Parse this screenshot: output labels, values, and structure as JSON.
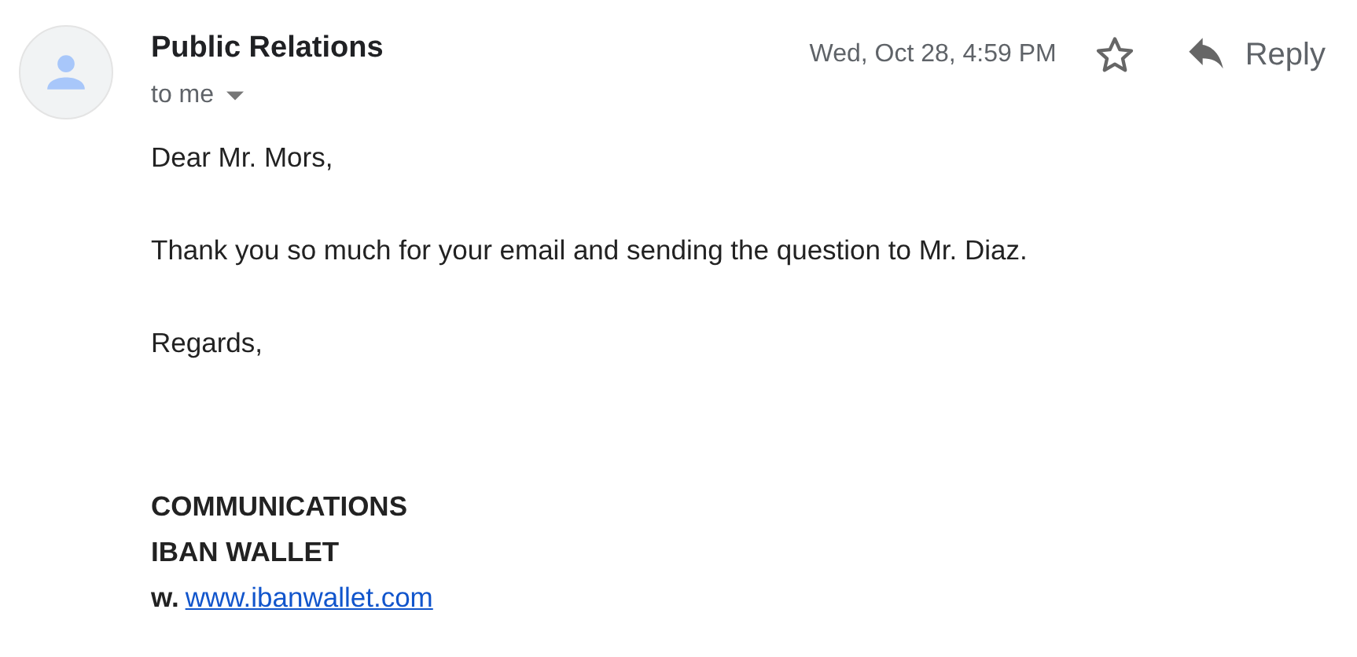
{
  "sender": {
    "name": "Public Relations",
    "recipient": "to me"
  },
  "date": "Wed, Oct 28, 4:59 PM",
  "starred": false,
  "reply_button": {
    "label": "Reply"
  },
  "body": [
    "Dear Mr. Mors,",
    "Thank you so much for your email and sending the question to Mr. Diaz.",
    "Regards,"
  ],
  "signature": {
    "lines": [
      "COMMUNICATIONS",
      "IBAN WALLET"
    ],
    "website_label": "w.",
    "website": "www.ibanwallet.com"
  }
}
